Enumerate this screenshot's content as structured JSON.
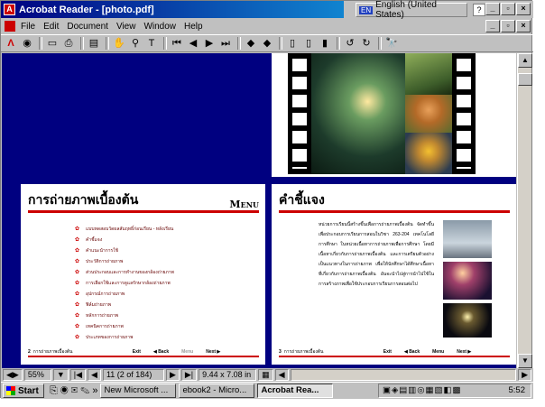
{
  "window": {
    "title": "Acrobat Reader - [photo.pdf]"
  },
  "language": {
    "badge": "EN",
    "label": "English (United States)"
  },
  "menu": [
    "File",
    "Edit",
    "Document",
    "View",
    "Window",
    "Help"
  ],
  "page_left": {
    "heading": "การถ่ายภาพเบื้องต้น",
    "menu_label": "Menu",
    "items": [
      "แบบทดสอบวัดผลสัมฤทธิ์ก่อนเรียน - หลังเรียน",
      "คำชี้แจง",
      "คำแนะนำการใช้",
      "ประวัติการถ่ายภาพ",
      "ส่วนประกอบและการทำงานของกล้องถ่ายภาพ",
      "การเลือกใช้และการดูแลรักษากล้องถ่ายภาพ",
      "อุปกรณ์การถ่ายภาพ",
      "ฟิล์มถ่ายภาพ",
      "หลักการถ่ายภาพ",
      "เทคนิคการถ่ายภาพ",
      "ประเภทของการถ่ายภาพ"
    ],
    "footer_num": "2",
    "footer_text": "การถ่ายภาพเบื้องต้น",
    "nav": [
      "Exit",
      "Back",
      "Menu",
      "Next"
    ]
  },
  "page_right": {
    "heading": "คำชี้แจง",
    "body": "หน่วยการเรียนนี้สร้างขึ้นเพื่อการถ่ายภาพเบื้องต้น จัดทำขึ้นเพื่อประกอบการเรียนการสอนในวิชา 263-204 เทคโนโลยีการศึกษา ในหน่วยเนื้อหาการถ่ายภาพเพื่อการศึกษา โดยมีเนื้อหาเกี่ยวกับการถ่ายภาพเบื้องต้น และการเตรียมตัวอย่างเป็นแนวทางในการถ่ายภาพ เพื่อให้นักศึกษาได้ศึกษาเนื้อหาที่เกี่ยวกับการถ่ายภาพเบื้องต้น อันจะนำไปสู่การนำไปใช้ในการสร้างภาพเพื่อใช้ประกอบการเรียนการสอนต่อไป",
    "footer_num": "3",
    "footer_text": "การถ่ายภาพเบื้องต้น",
    "nav": [
      "Exit",
      "Back",
      "Menu",
      "Next"
    ]
  },
  "status": {
    "zoom": "55%",
    "page": "11 (2 of 184)",
    "size": "9.44 x 7.08 in"
  },
  "taskbar": {
    "start": "Start",
    "tasks": [
      "New Microsoft ...",
      "ebook2 - Micro...",
      "Acrobat Rea..."
    ],
    "clock": "5:52"
  },
  "colors": {
    "accent": "#000080",
    "heading_red": "#c00000"
  }
}
